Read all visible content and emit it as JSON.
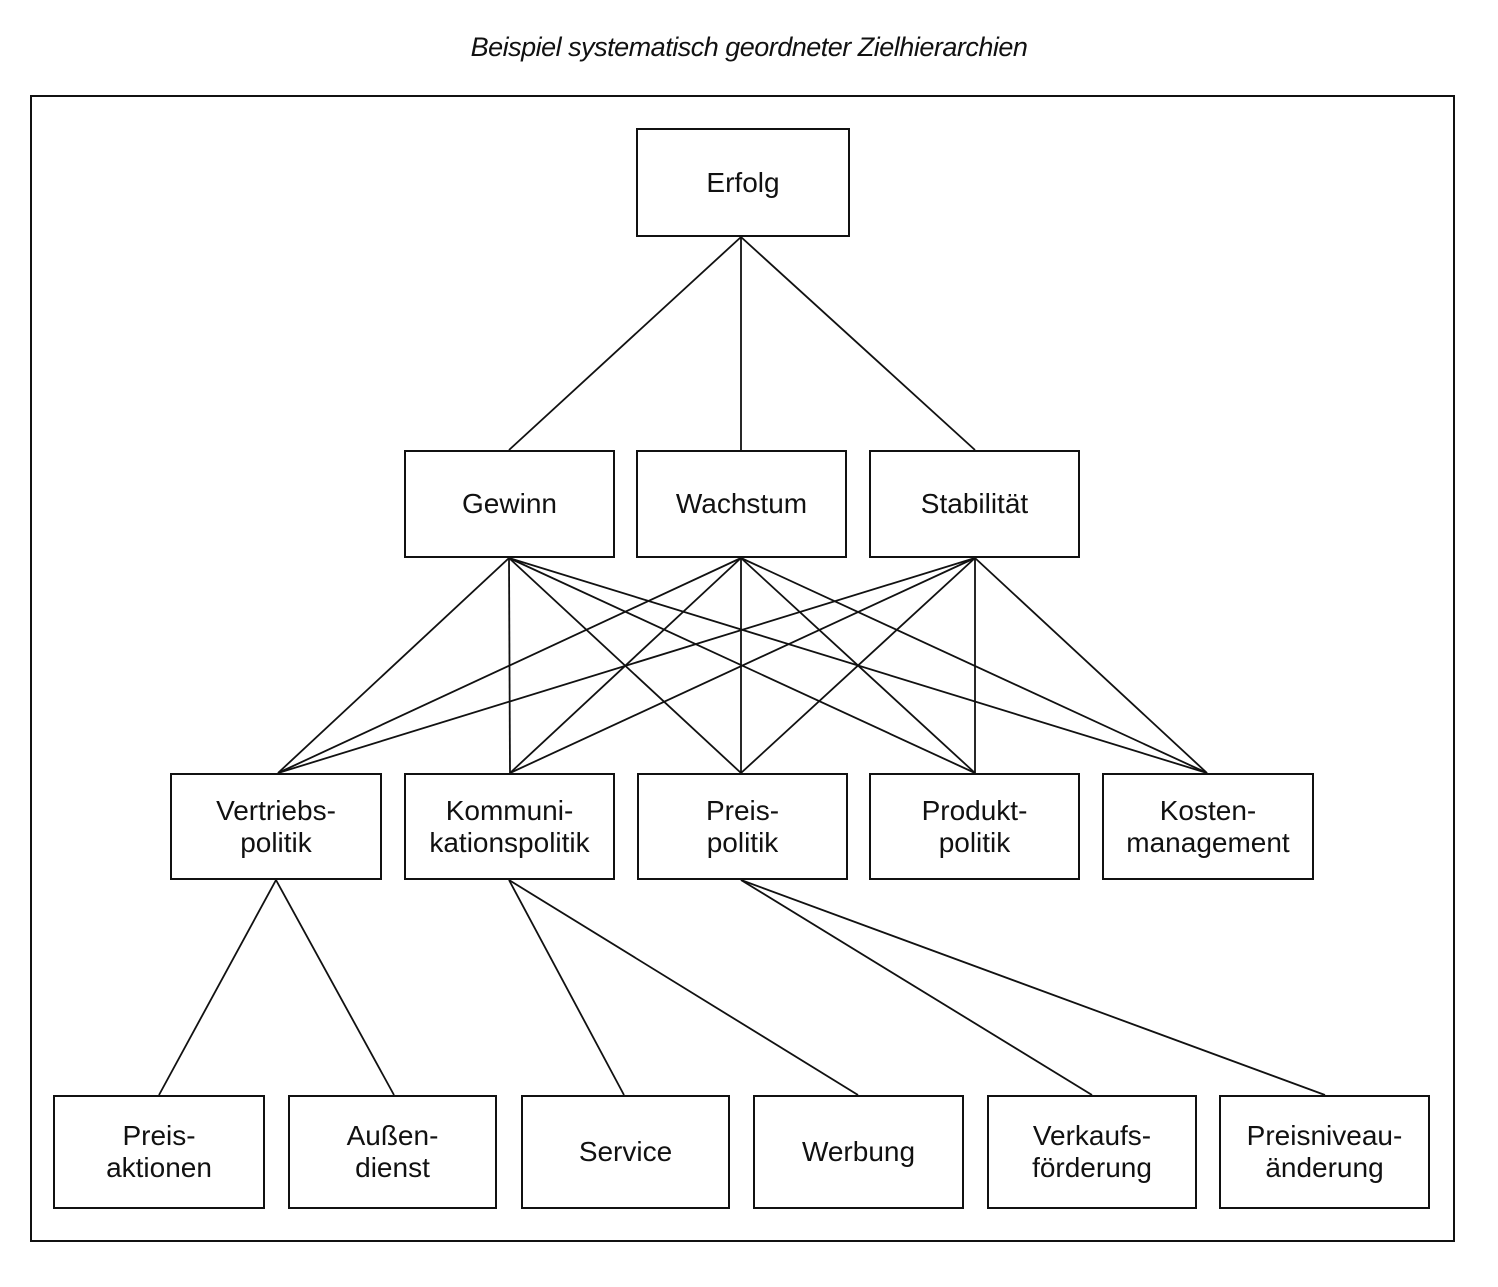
{
  "title": "Beispiel systematisch geordneter Zielhierarchien",
  "levels": {
    "top": [
      "Erfolg"
    ],
    "goals": [
      "Gewinn",
      "Wachstum",
      "Stabilität"
    ],
    "policies": [
      "Vertriebs-\npolitik",
      "Kommuni-\nkationspolitik",
      "Preis-\npolitik",
      "Produkt-\npolitik",
      "Kosten-\nmanagement"
    ],
    "measures": [
      "Preis-\naktionen",
      "Außen-\ndienst",
      "Service",
      "Werbung",
      "Verkaufs-\nförderung",
      "Preisniveau-\nänderung"
    ]
  },
  "connections": {
    "top_to_goals": [
      [
        0,
        0
      ],
      [
        0,
        1
      ],
      [
        0,
        2
      ]
    ],
    "goals_to_policies": "all-to-all",
    "policies_to_measures": [
      [
        0,
        0
      ],
      [
        0,
        1
      ],
      [
        1,
        2
      ],
      [
        1,
        3
      ],
      [
        2,
        4
      ],
      [
        2,
        5
      ]
    ]
  }
}
